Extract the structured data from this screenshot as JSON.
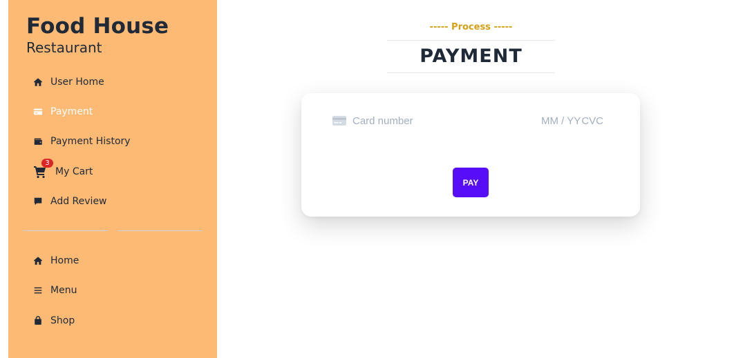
{
  "brand": {
    "title": "Food House",
    "subtitle": "Restaurant"
  },
  "sidebar": {
    "items": [
      {
        "label": "User Home",
        "icon": "home-icon"
      },
      {
        "label": "Payment",
        "icon": "credit-card-icon",
        "active": true
      },
      {
        "label": "Payment History",
        "icon": "wallet-icon"
      },
      {
        "label": "My Cart",
        "icon": "cart-icon",
        "badge": "3"
      },
      {
        "label": "Add Review",
        "icon": "comment-icon"
      }
    ],
    "secondary_items": [
      {
        "label": "Home",
        "icon": "home-icon"
      },
      {
        "label": "Menu",
        "icon": "menu-icon"
      },
      {
        "label": "Shop",
        "icon": "shopping-bag-icon"
      }
    ]
  },
  "page": {
    "subtitle": "----- Process -----",
    "title": "PAYMENT"
  },
  "payment_form": {
    "card_number_placeholder": "Card number",
    "expiry_placeholder": "MM / YY",
    "cvc_placeholder": "CVC",
    "pay_label": "PAY"
  },
  "colors": {
    "sidebar_bg": "#fdba74",
    "accent_gold": "#d4a017",
    "pay_button": "#570df8",
    "badge": "#dc2626"
  }
}
